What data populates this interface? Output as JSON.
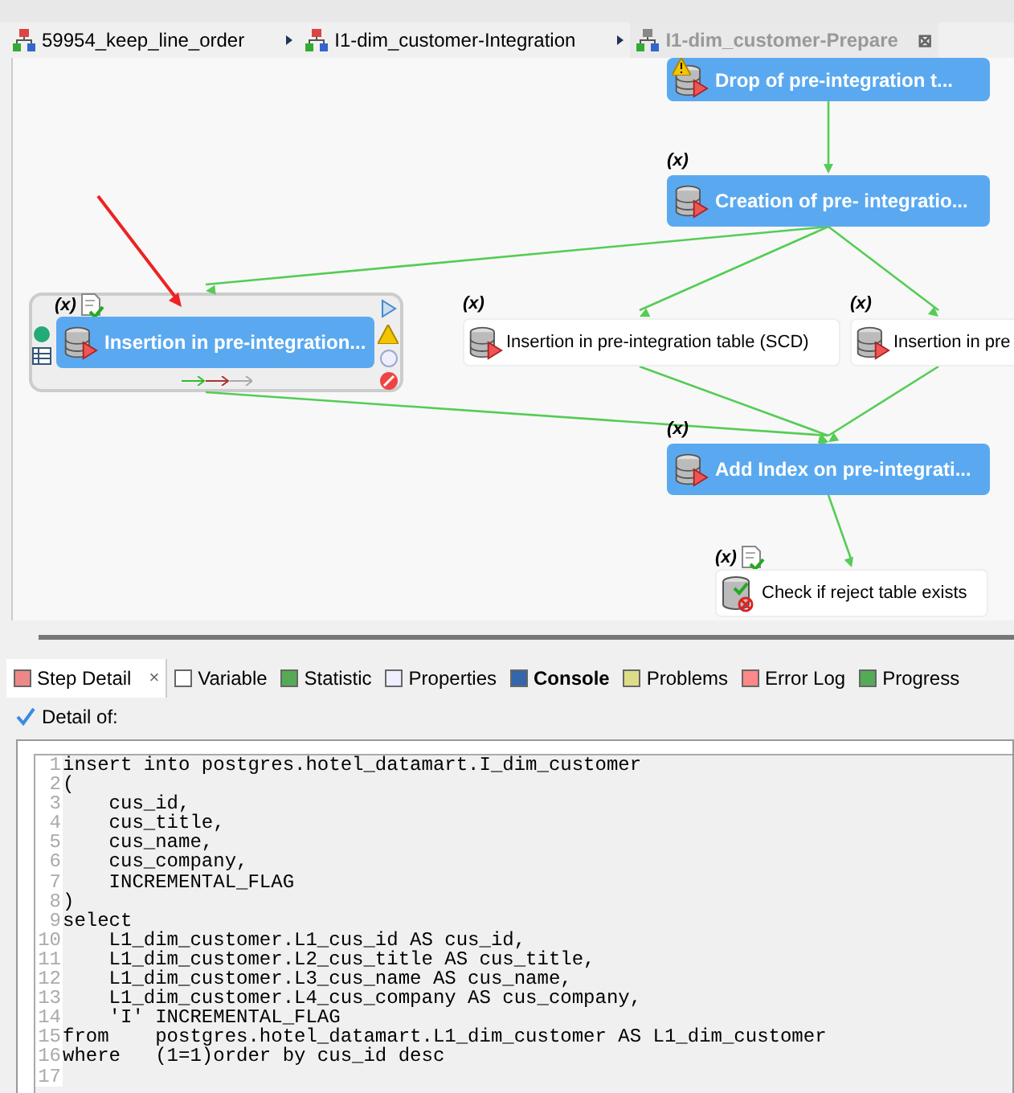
{
  "breadcrumbs": [
    {
      "label": "59954_keep_line_order",
      "selected": false
    },
    {
      "label": "I1-dim_customer-Integration",
      "selected": false
    },
    {
      "label": "I1-dim_customer-Prepare",
      "selected": true,
      "close": "⊠"
    }
  ],
  "diagram": {
    "nodes": [
      {
        "label": "Drop of pre-integration t...",
        "kind": "active",
        "warning": true
      },
      {
        "label": "Creation of pre- integratio...",
        "kind": "active",
        "var": "(x)"
      },
      {
        "label": "Insertion in pre-integration...",
        "kind": "active",
        "var": "(x)",
        "checked_doc": true,
        "selected": true
      },
      {
        "label": "Insertion in pre-integration table (SCD)",
        "kind": "plain",
        "var": "(x)"
      },
      {
        "label": "Insertion in pre",
        "kind": "plain",
        "var": "(x)"
      },
      {
        "label": "Add Index on pre-integrati...",
        "kind": "active",
        "var": "(x)"
      },
      {
        "label": "Check if reject table exists",
        "kind": "check",
        "var": "(x)",
        "checked_doc": true
      }
    ]
  },
  "tabs": [
    {
      "label": "Step Detail",
      "selected": true,
      "bold": false,
      "close": "×"
    },
    {
      "label": "Variable",
      "selected": false,
      "bold": false
    },
    {
      "label": "Statistic",
      "selected": false,
      "bold": false
    },
    {
      "label": "Properties",
      "selected": false,
      "bold": false
    },
    {
      "label": "Console",
      "selected": false,
      "bold": true
    },
    {
      "label": "Problems",
      "selected": false,
      "bold": false
    },
    {
      "label": "Error Log",
      "selected": false,
      "bold": false
    },
    {
      "label": "Progress",
      "selected": false,
      "bold": false
    }
  ],
  "detail_label": "Detail of:",
  "code": [
    {
      "n": "1",
      "text": "insert into postgres.hotel_datamart.I_dim_customer"
    },
    {
      "n": "2",
      "text": "("
    },
    {
      "n": "3",
      "text": "    cus_id,"
    },
    {
      "n": "4",
      "text": "    cus_title,"
    },
    {
      "n": "5",
      "text": "    cus_name,"
    },
    {
      "n": "6",
      "text": "    cus_company,"
    },
    {
      "n": "7",
      "text": "    INCREMENTAL_FLAG"
    },
    {
      "n": "8",
      "text": ")"
    },
    {
      "n": "9",
      "text": "select"
    },
    {
      "n": "10",
      "text": "    L1_dim_customer.L1_cus_id AS cus_id,"
    },
    {
      "n": "11",
      "text": "    L1_dim_customer.L2_cus_title AS cus_title,"
    },
    {
      "n": "12",
      "text": "    L1_dim_customer.L3_cus_name AS cus_name,"
    },
    {
      "n": "13",
      "text": "    L1_dim_customer.L4_cus_company AS cus_company,"
    },
    {
      "n": "14",
      "text": "    'I' INCREMENTAL_FLAG"
    },
    {
      "n": "15",
      "text": "from    postgres.hotel_datamart.L1_dim_customer AS L1_dim_customer"
    },
    {
      "n": "16",
      "text": "where   (1=1)order by cus_id desc"
    },
    {
      "n": "17"
    }
  ]
}
